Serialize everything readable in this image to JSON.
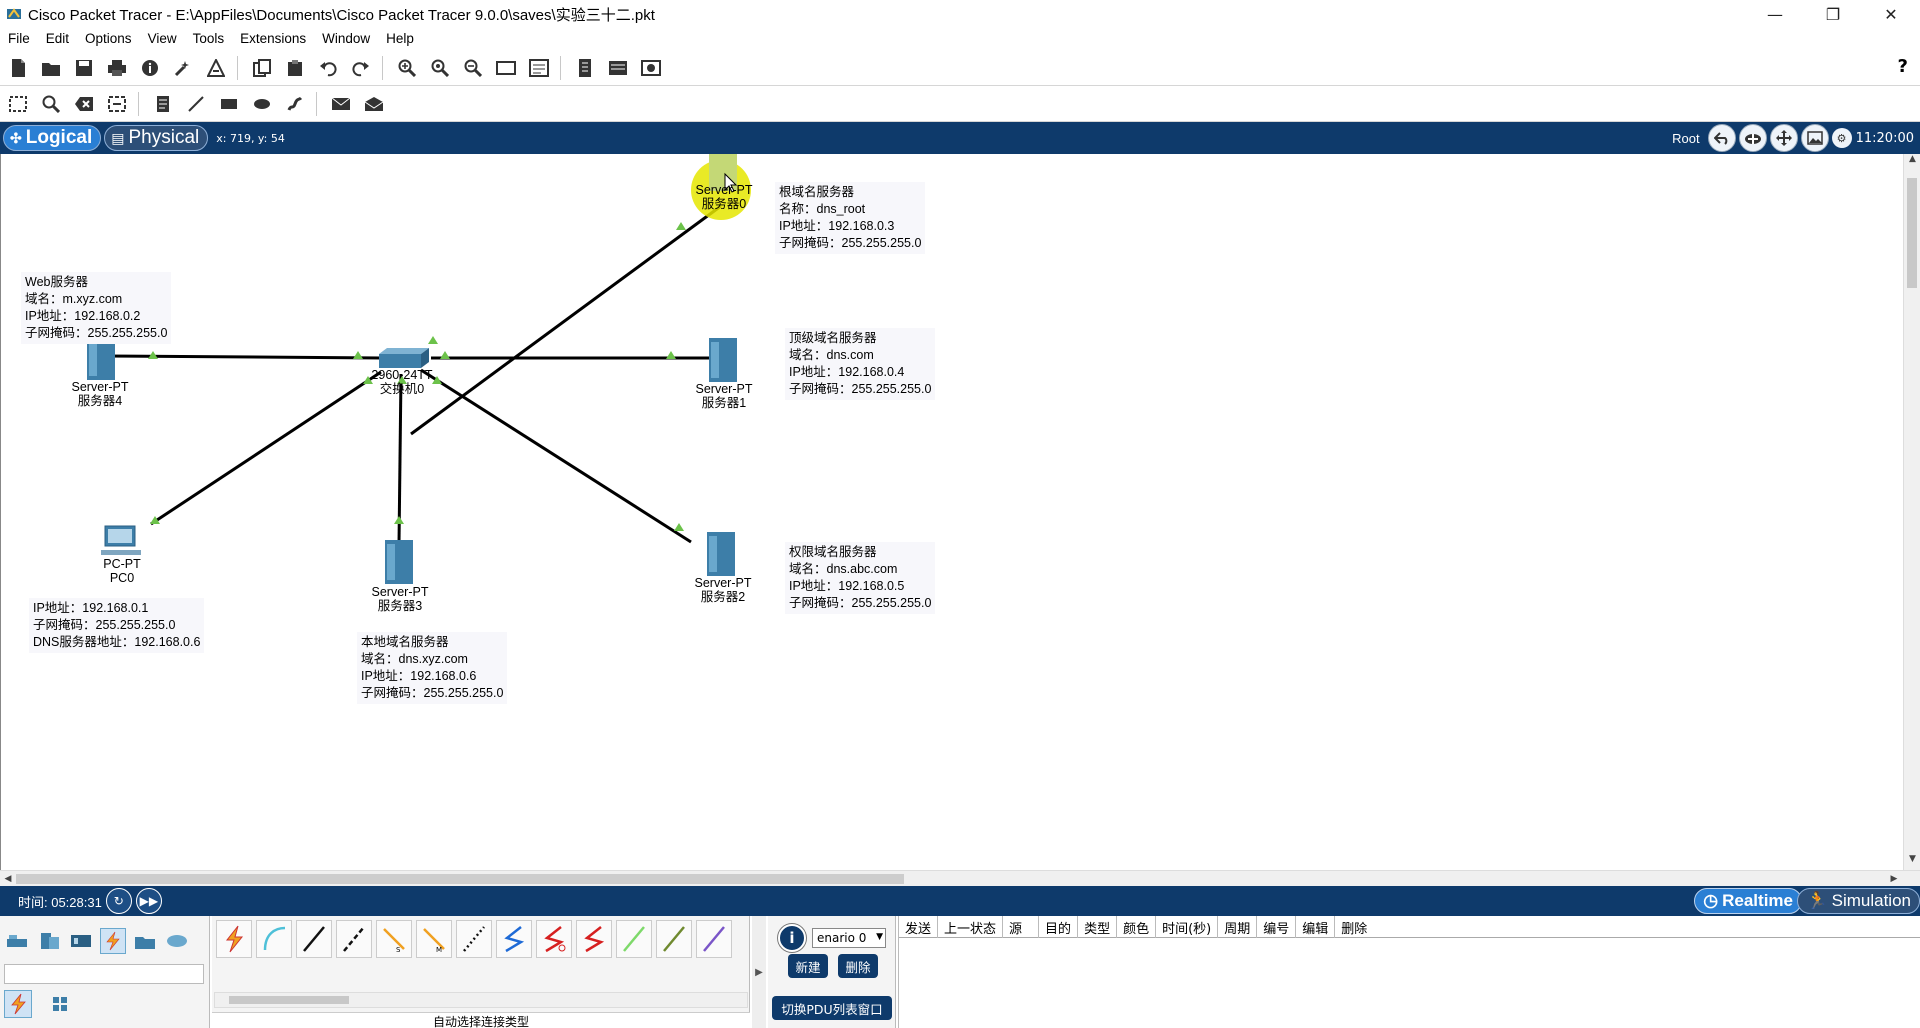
{
  "window": {
    "title": "Cisco Packet Tracer - E:\\AppFiles\\Documents\\Cisco Packet Tracer 9.0.0\\saves\\实验三十二.pkt",
    "controls": [
      "—",
      "❐",
      "✕"
    ]
  },
  "menu": [
    "File",
    "Edit",
    "Options",
    "View",
    "Tools",
    "Extensions",
    "Window",
    "Help"
  ],
  "toolbar1": [
    "new-icon",
    "open-icon",
    "save-icon",
    "print-icon",
    "info-icon",
    "wizard-icon",
    "activity-icon",
    "copy-icon",
    "paste-icon",
    "undo-icon",
    "redo-icon",
    "zoom-in-icon",
    "zoom-reset-icon",
    "zoom-out-icon",
    "drawing-palette-icon",
    "custom-device-icon",
    "cluster-icon",
    "viewport-icon",
    "screenshot-icon"
  ],
  "toolbar2": [
    "select-icon",
    "inspect-icon",
    "delete-icon",
    "resize-icon",
    "note-icon",
    "line-icon",
    "rectangle-icon",
    "ellipse-icon",
    "freeform-icon",
    "add-simple-pdu-icon",
    "add-complex-pdu-icon"
  ],
  "help": "?",
  "mode": {
    "logical": "Logical",
    "physical": "Physical",
    "coords": "x: 719, y: 54",
    "root": "Root",
    "clock": "11:20:00"
  },
  "devices": [
    {
      "id": "server0",
      "model": "Server-PT",
      "name": "服务器0"
    },
    {
      "id": "server1",
      "model": "Server-PT",
      "name": "服务器1"
    },
    {
      "id": "server2",
      "model": "Server-PT",
      "name": "服务器2"
    },
    {
      "id": "server3",
      "model": "Server-PT",
      "name": "服务器3"
    },
    {
      "id": "server4",
      "model": "Server-PT",
      "name": "服务器4"
    },
    {
      "id": "pc0",
      "model": "PC-PT",
      "name": "PC0"
    },
    {
      "id": "switch0",
      "model": "2960-24TT",
      "name": "交换机0"
    }
  ],
  "notes": {
    "root": [
      "根域名服务器",
      "名称：dns_root",
      "IP地址：192.168.0.3",
      "子网掩码：255.255.255.0"
    ],
    "top": [
      "顶级域名服务器",
      "域名：dns.com",
      "IP地址：192.168.0.4",
      "子网掩码：255.255.255.0"
    ],
    "auth": [
      "权限域名服务器",
      "域名：dns.abc.com",
      "IP地址：192.168.0.5",
      "子网掩码：255.255.255.0"
    ],
    "web": [
      "Web服务器",
      "域名：m.xyz.com",
      "IP地址：192.168.0.2",
      "子网掩码：255.255.255.0"
    ],
    "pc": [
      "IP地址：192.168.0.1",
      "子网掩码：255.255.255.0",
      "DNS服务器地址：192.168.0.6"
    ],
    "local": [
      "本地域名服务器",
      "域名：dns.xyz.com",
      "IP地址：192.168.0.6",
      "子网掩码：255.255.255.0"
    ]
  },
  "timebar": {
    "time": "时间: 05:28:31",
    "realtime": "Realtime",
    "simulation": "Simulation"
  },
  "bottom": {
    "auto_cable": "自动选择连接类型",
    "scenario": "enario 0",
    "new": "新建",
    "delete": "删除",
    "toggle_pdu": "切换PDU列表窗口",
    "pdu_columns": [
      "发送",
      "上一状态",
      "源",
      "目的",
      "类型",
      "颜色",
      "时间(秒)",
      "周期",
      "编号",
      "编辑",
      "删除"
    ]
  },
  "colors": {
    "bar_blue": "#0e3a6b",
    "link": "#000000",
    "port_up": "#6cc24a",
    "server_body": "#3d7ea8",
    "highlight": "#e5e600"
  }
}
